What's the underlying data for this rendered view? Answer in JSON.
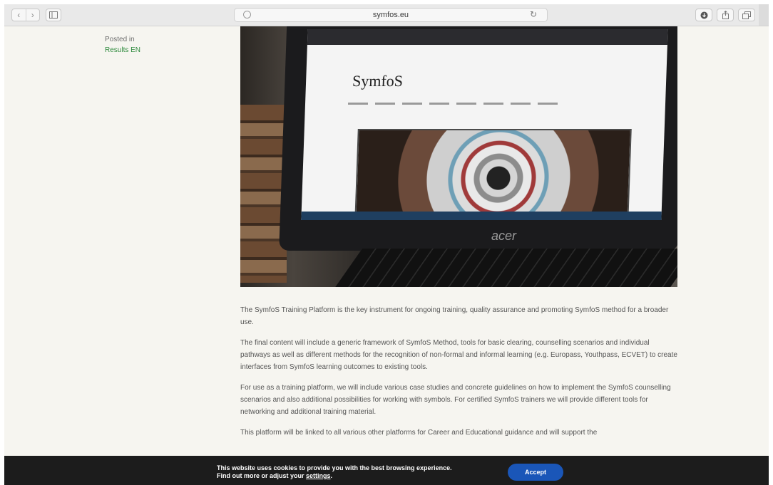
{
  "browser": {
    "url": "symfos.eu",
    "nav_back": "‹",
    "nav_forward": "›",
    "sidebar_icon": "sidebar-icon",
    "reload_icon": "reload-icon",
    "download_icon": "download-icon",
    "share_icon": "share-icon",
    "tabs_icon": "tabs-icon"
  },
  "post": {
    "posted_in_label": "Posted in",
    "category": "Results EN",
    "hero": {
      "screen_logo": "SymfoS",
      "brand": "acer"
    },
    "paragraphs": [
      "The SymfoS Training Platform is the key instrument for ongoing training, quality assurance and promoting SymfoS method for a broader use.",
      "The final content will include a generic framework of SymfoS Method, tools for basic clearing, counselling scenarios and individual pathways as well as different methods for the recognition of non-formal and informal learning (e.g. Europass, Youthpass, ECVET) to create interfaces from SymfoS learning outcomes to existing tools.",
      "For use as a training platform, we will include various case studies and concrete guidelines on how to implement the SymfoS counselling scenarios and also additional possibilities for working with symbols. For certified SymfoS trainers we will provide different tools for networking and additional training material.",
      "This platform will be linked to all various other platforms for Career and Educational guidance and will support the"
    ]
  },
  "cookie": {
    "line1": "This website uses cookies to provide you with the best browsing experience.",
    "line2_prefix": "Find out more or adjust your ",
    "line2_link": "settings",
    "line2_suffix": ".",
    "accept_label": "Accept"
  }
}
